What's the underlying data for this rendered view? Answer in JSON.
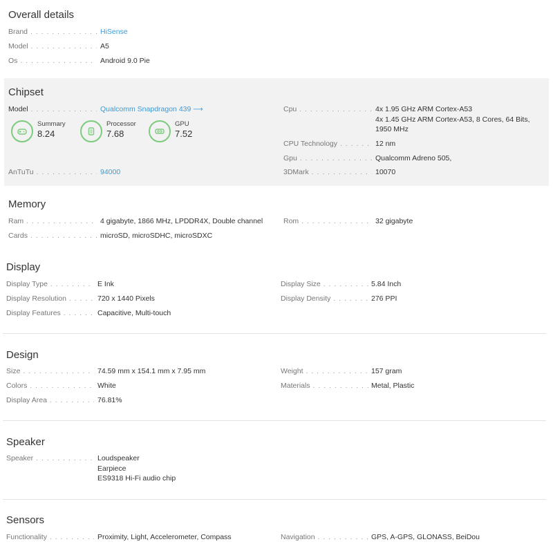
{
  "overall": {
    "title": "Overall details",
    "brand_label": "Brand",
    "brand_value": "HiSense",
    "model_label": "Model",
    "model_value": "A5",
    "os_label": "Os",
    "os_value": "Android 9.0 Pie"
  },
  "chipset": {
    "title": "Chipset",
    "model_label": "Model",
    "model_value": "Qualcomm Snapdragon 439",
    "arrow": "⟶",
    "scores": [
      {
        "label": "Summary",
        "value": "8.24",
        "icon": "gamepad-icon"
      },
      {
        "label": "Processor",
        "value": "7.68",
        "icon": "chip-icon"
      },
      {
        "label": "GPU",
        "value": "7.52",
        "icon": "gpu-icon"
      }
    ],
    "antutu_label": "AnTuTu",
    "antutu_value": "94000",
    "cpu_label": "Cpu",
    "cpu_lines": [
      "4x 1.95 GHz ARM Cortex-A53",
      "4x 1.45 GHz ARM Cortex-A53, 8 Cores, 64 Bits,",
      "1950 MHz"
    ],
    "cputech_label": "CPU Technology",
    "cputech_value": "12 nm",
    "gpu_label": "Gpu",
    "gpu_value": "Qualcomm Adreno 505,",
    "threedmark_label": "3DMark",
    "threedmark_value": "10070",
    "ring_color": "#7ccb7c"
  },
  "memory": {
    "title": "Memory",
    "ram_label": "Ram",
    "ram_value": "4 gigabyte, 1866 MHz, LPDDR4X, Double channel",
    "rom_label": "Rom",
    "rom_value": "32 gigabyte",
    "cards_label": "Cards",
    "cards_value": "microSD, microSDHC, microSDXC"
  },
  "display": {
    "title": "Display",
    "type_label": "Display Type",
    "type_value": "E Ink",
    "size_label": "Display Size",
    "size_value": "5.84 Inch",
    "resolution_label": "Display Resolution",
    "resolution_value": "720 x 1440 Pixels",
    "density_label": "Display Density",
    "density_value": "276 PPI",
    "features_label": "Display Features",
    "features_value": "Capacitive, Multi-touch"
  },
  "design": {
    "title": "Design",
    "size_label": "Size",
    "size_value": "74.59 mm x 154.1 mm x 7.95 mm",
    "weight_label": "Weight",
    "weight_value": "157 gram",
    "colors_label": "Colors",
    "colors_value": "White",
    "materials_label": "Materials",
    "materials_value": "Metal, Plastic",
    "area_label": "Display Area",
    "area_value": "76.81%"
  },
  "speaker": {
    "title": "Speaker",
    "speaker_label": "Speaker",
    "speaker_lines": [
      "Loudspeaker",
      "Earpiece",
      "ES9318 Hi-Fi audio chip"
    ]
  },
  "sensors": {
    "title": "Sensors",
    "functionality_label": "Functionality",
    "functionality_value": "Proximity, Light, Accelerometer, Compass",
    "navigation_label": "Navigation",
    "navigation_value": "GPS, A-GPS, GLONASS, BeiDou"
  }
}
